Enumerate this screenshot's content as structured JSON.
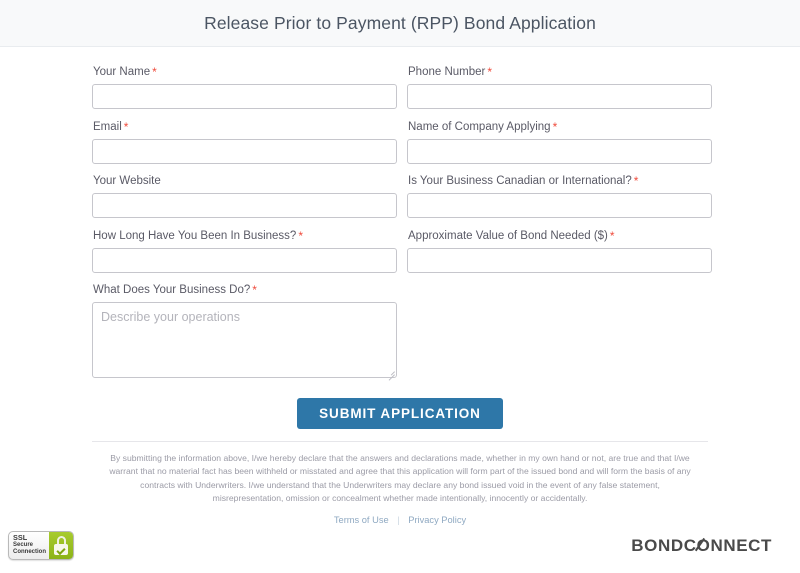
{
  "header": {
    "title": "Release Prior to Payment (RPP) Bond Application"
  },
  "form": {
    "fields": [
      {
        "name": "your-name",
        "label": "Your Name",
        "required": "*",
        "value": "",
        "placeholder": ""
      },
      {
        "name": "phone-number",
        "label": "Phone Number",
        "required": "*",
        "value": "",
        "placeholder": ""
      },
      {
        "name": "email",
        "label": "Email",
        "required": "*",
        "value": "",
        "placeholder": ""
      },
      {
        "name": "company-name",
        "label": "Name of Company Applying",
        "required": "*",
        "value": "",
        "placeholder": ""
      },
      {
        "name": "website",
        "label": "Your Website",
        "required": "",
        "value": "",
        "placeholder": ""
      },
      {
        "name": "business-origin",
        "label": "Is Your Business Canadian or International?",
        "required": "*",
        "value": "",
        "placeholder": ""
      },
      {
        "name": "years-in-business",
        "label": "How Long Have You Been In Business?",
        "required": "*",
        "value": "",
        "placeholder": ""
      },
      {
        "name": "bond-value",
        "label": "Approximate Value of Bond Needed ($)",
        "required": "*",
        "value": "",
        "placeholder": ""
      }
    ],
    "business_description": {
      "label": "What Does Your Business Do?",
      "required": "*",
      "value": "",
      "placeholder": "Describe your operations"
    },
    "submit_label": "SUBMIT APPLICATION",
    "accent_color": "#2e77a8",
    "required_color": "#ef4b3c"
  },
  "disclaimer": {
    "text": "By submitting the information above, I/we hereby declare that the answers and declarations made, whether in my own hand or not, are true and that I/we warrant that no material fact has been withheld or misstated and agree that this application will form part of the issued bond and will form the basis of any contracts with Underwriters. I/we understand that the Underwriters may declare any bond issued void in the event of any false statement, misrepresentation, omission or concealment whether made intentionally, innocently or accidentally."
  },
  "links": {
    "terms": "Terms of Use",
    "separator": "|",
    "privacy": "Privacy Policy"
  },
  "footer": {
    "ssl_badge": {
      "line1": "SSL",
      "line2": "Secure",
      "line3": "Connection",
      "lock_color": "#9cc224"
    },
    "brand": {
      "part1": "BONDC",
      "part2": "O",
      "part3": "NNECT",
      "full": "BONDCONNECT"
    }
  }
}
